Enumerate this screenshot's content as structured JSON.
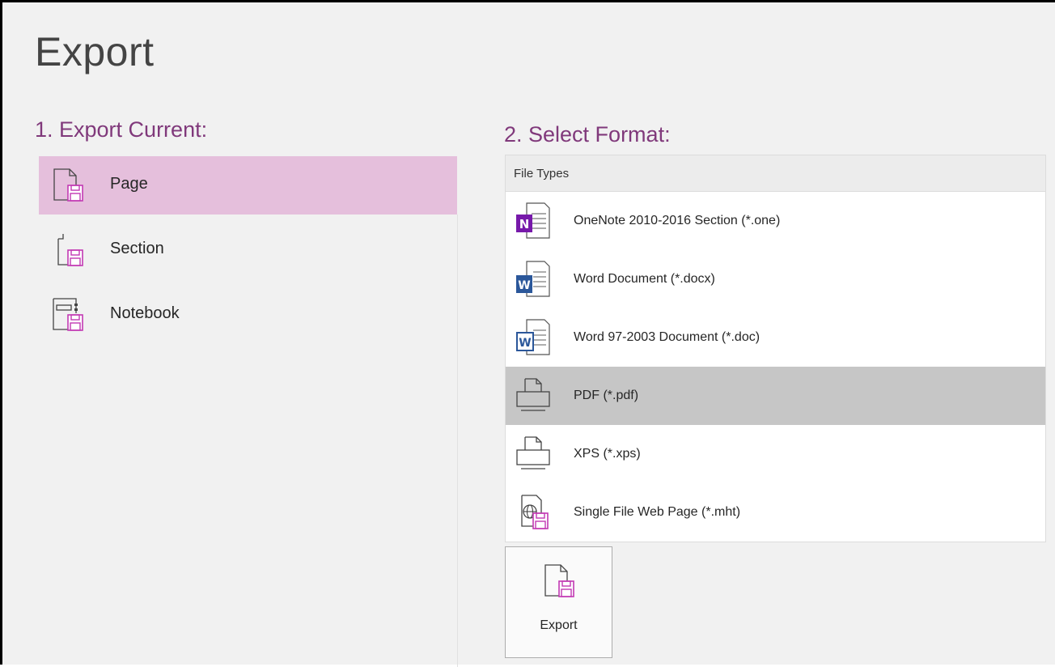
{
  "page": {
    "title": "Export"
  },
  "export_current": {
    "heading": "1. Export Current:",
    "items": [
      {
        "label": "Page",
        "icon": "page-save-icon",
        "selected": true
      },
      {
        "label": "Section",
        "icon": "section-save-icon",
        "selected": false
      },
      {
        "label": "Notebook",
        "icon": "notebook-save-icon",
        "selected": false
      }
    ]
  },
  "select_format": {
    "heading": "2. Select Format:",
    "list_header": "File Types",
    "items": [
      {
        "label": "OneNote 2010-2016 Section (*.one)",
        "icon": "onenote-file-icon",
        "selected": false
      },
      {
        "label": "Word Document (*.docx)",
        "icon": "word-docx-icon",
        "selected": false
      },
      {
        "label": "Word 97-2003 Document (*.doc)",
        "icon": "word-doc-icon",
        "selected": false
      },
      {
        "label": "PDF (*.pdf)",
        "icon": "printer-icon",
        "selected": true
      },
      {
        "label": "XPS (*.xps)",
        "icon": "printer-icon",
        "selected": false
      },
      {
        "label": "Single File Web Page (*.mht)",
        "icon": "web-page-save-icon",
        "selected": false
      }
    ]
  },
  "export_button": {
    "label": "Export",
    "icon": "export-save-icon"
  },
  "colors": {
    "accent": "#80397b",
    "selected_scope_bg": "#e5bfdc",
    "selected_format_bg": "#c6c6c6",
    "save_icon": "#c239b3",
    "onenote_purple": "#7719aa",
    "word_blue": "#2b579a"
  }
}
